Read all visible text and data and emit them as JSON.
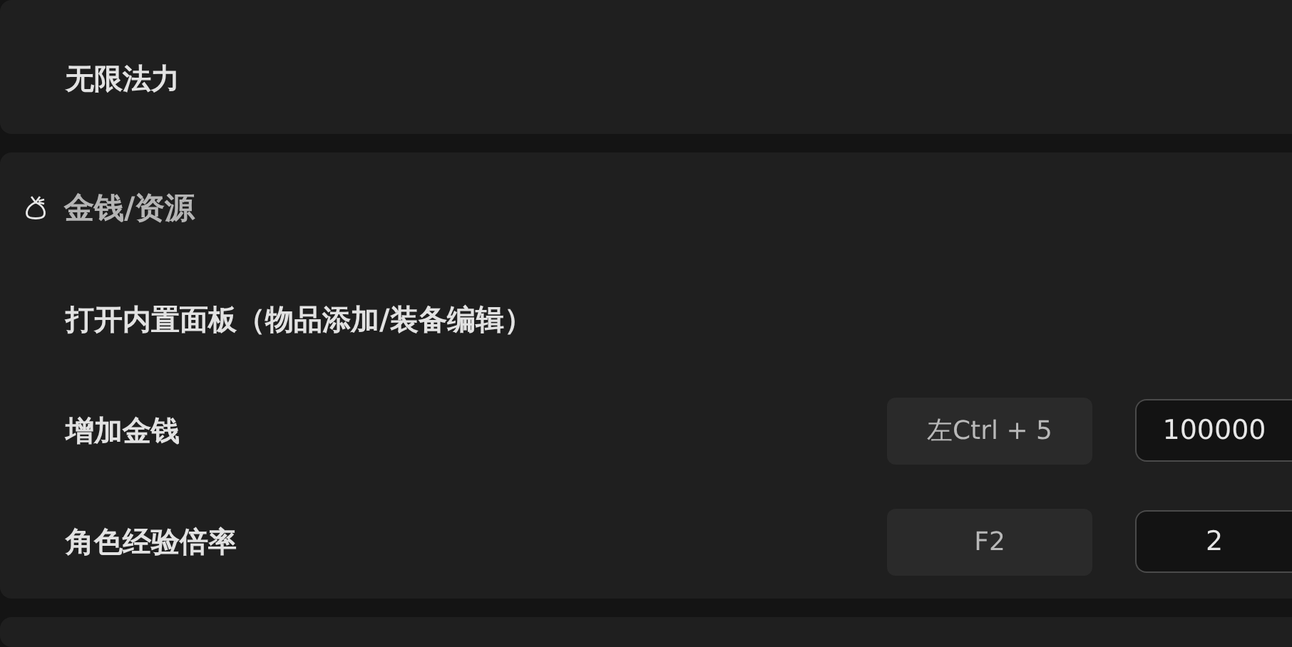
{
  "sections": [
    {
      "items": [
        {
          "kind": "plain",
          "label": "无限法力"
        }
      ]
    },
    {
      "title": "金钱/资源",
      "items": [
        {
          "kind": "plain",
          "label": "打开内置面板（物品添加/装备编辑）"
        },
        {
          "kind": "hotkey",
          "label": "增加金钱",
          "hotkey": "左Ctrl + 5",
          "value": "100000"
        },
        {
          "kind": "hotkey",
          "label": "角色经验倍率",
          "hotkey": "F2",
          "value": "2"
        }
      ]
    }
  ]
}
